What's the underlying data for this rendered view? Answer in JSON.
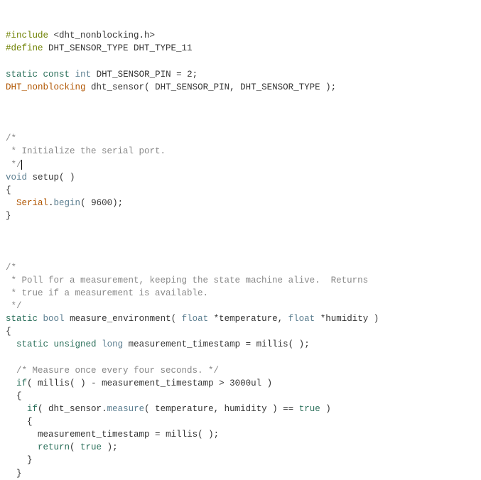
{
  "code": {
    "line1": {
      "preproc": "#include",
      "rest": " <dht_nonblocking.h>"
    },
    "line2": {
      "preproc": "#define",
      "macro": " DHT_SENSOR_TYPE DHT_TYPE_11"
    },
    "line3": "",
    "line4": {
      "kw_static": "static",
      "kw_const": "const",
      "type_int": "int",
      "ident": "DHT_SENSOR_PIN",
      "eq": " = ",
      "val": "2",
      "semi": ";"
    },
    "line5": {
      "class": "DHT_nonblocking",
      "ident": "dht_sensor",
      "open": "( ",
      "arg1": "DHT_SENSOR_PIN",
      "comma": ", ",
      "arg2": "DHT_SENSOR_TYPE",
      "close": " );"
    },
    "line6": "",
    "line7": "",
    "line8": "",
    "line9": "/*",
    "line10": " * Initialize the serial port.",
    "line11": " */",
    "line12": {
      "type_void": "void",
      "func": "setup",
      "parens": "( )"
    },
    "line13": "{",
    "line14": {
      "indent": "  ",
      "obj": "Serial",
      "dot": ".",
      "method": "begin",
      "open": "( ",
      "arg": "9600",
      "close": ");"
    },
    "line15": "}",
    "line16": "",
    "line17": "",
    "line18": "",
    "line19": "/*",
    "line20": " * Poll for a measurement, keeping the state machine alive.  Returns",
    "line21": " * true if a measurement is available.",
    "line22": " */",
    "line23": {
      "kw_static": "static",
      "type_bool": "bool",
      "func": "measure_environment",
      "open": "( ",
      "type_float1": "float",
      "star1": " *",
      "arg1": "temperature",
      "comma": ", ",
      "type_float2": "float",
      "star2": " *",
      "arg2": "humidity",
      "close": " )"
    },
    "line24": "{",
    "line25": {
      "indent": "  ",
      "kw_static": "static",
      "kw_unsigned": "unsigned",
      "type_long": "long",
      "ident": "measurement_timestamp",
      "eq": " = ",
      "func": "millis",
      "parens": "( )",
      "semi": ";"
    },
    "line26": "",
    "line27": {
      "indent": "  ",
      "comment": "/* Measure once every four seconds. */"
    },
    "line28": {
      "indent": "  ",
      "kw_if": "if",
      "open": "( ",
      "func": "millis",
      "parens": "( )",
      "op": " - ",
      "ident": "measurement_timestamp",
      "gt": " > ",
      "val": "3000ul",
      "close": " )"
    },
    "line29": {
      "indent": "  ",
      "brace": "{"
    },
    "line30": {
      "indent": "    ",
      "kw_if": "if",
      "open": "( ",
      "obj": "dht_sensor",
      "dot": ".",
      "method": "measure",
      "mopen": "( ",
      "arg1": "temperature",
      "comma": ", ",
      "arg2": "humidity",
      "mclose": " )",
      "eqeq": " == ",
      "true": "true",
      "close": " )"
    },
    "line31": {
      "indent": "    ",
      "brace": "{"
    },
    "line32": {
      "indent": "      ",
      "ident": "measurement_timestamp",
      "eq": " = ",
      "func": "millis",
      "parens": "( )",
      "semi": ";"
    },
    "line33": {
      "indent": "      ",
      "kw_return": "return",
      "open": "( ",
      "true": "true",
      "close": " );"
    },
    "line34": {
      "indent": "    ",
      "brace": "}"
    },
    "line35": {
      "indent": "  ",
      "brace": "}"
    }
  }
}
